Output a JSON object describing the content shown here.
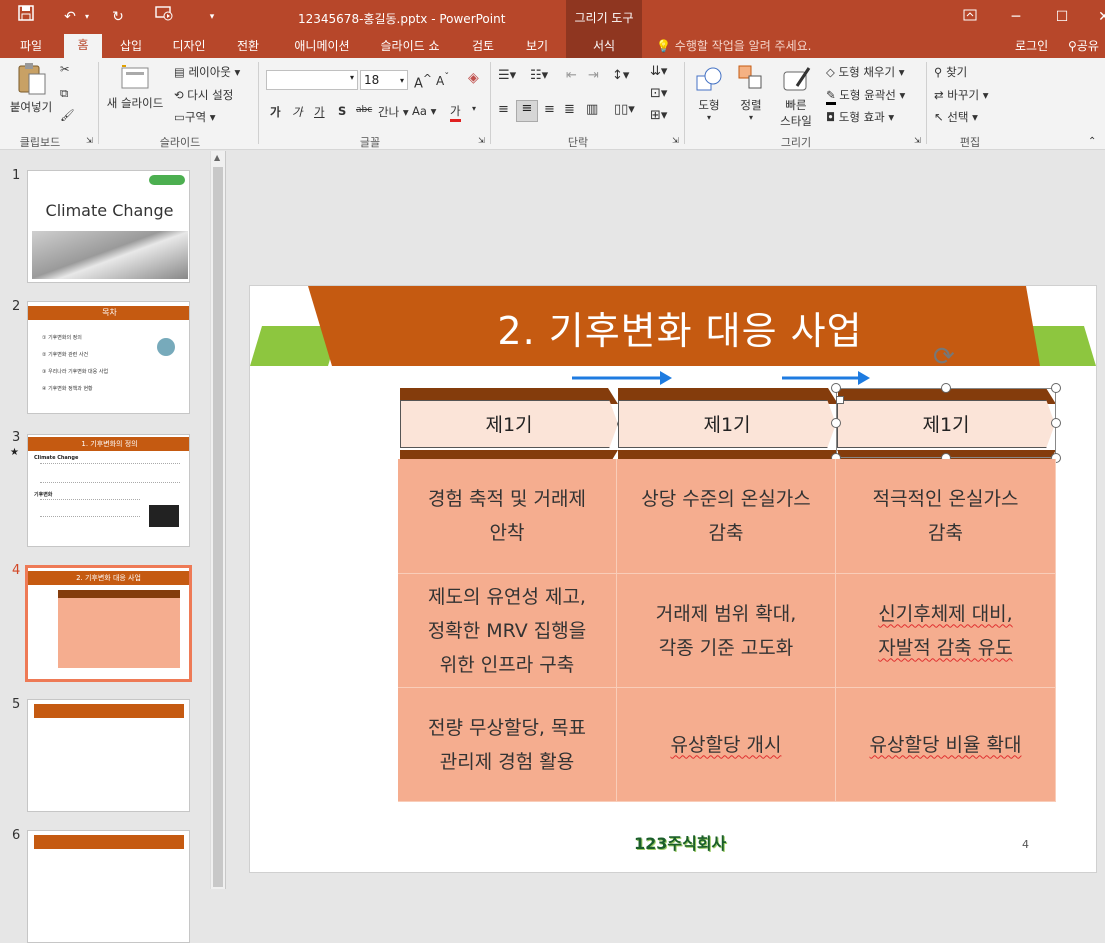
{
  "titlebar": {
    "filename": "12345678-홍길동.pptx - PowerPoint",
    "context_tool": "그리기 도구",
    "context_tab": "서식",
    "tell_me": "수행할 작업을 알려 주세요.",
    "login": "로그인",
    "share": "공유"
  },
  "tabs": [
    "파일",
    "홈",
    "삽입",
    "디자인",
    "전환",
    "애니메이션",
    "슬라이드 쇼",
    "검토",
    "보기"
  ],
  "ribbon": {
    "clipboard": {
      "paste": "붙여넣기",
      "group": "클립보드"
    },
    "slides": {
      "new_slide": "새 슬라이드",
      "layout": "레이아웃",
      "reset": "다시 설정",
      "section": "구역",
      "group": "슬라이드"
    },
    "font": {
      "font_name": "",
      "font_size": "18",
      "group": "글꼴",
      "bold": "가",
      "italic": "가",
      "underline": "가",
      "shadow": "S",
      "strike": "abc",
      "spacing": "간나",
      "case": "Aa",
      "color": "가"
    },
    "paragraph": {
      "group": "단락"
    },
    "drawing": {
      "shapes": "도형",
      "arrange": "정렬",
      "quick_styles_1": "빠른",
      "quick_styles_2": "스타일",
      "fill": "도형 채우기",
      "outline": "도형 윤곽선",
      "effects": "도형 효과",
      "group": "그리기"
    },
    "editing": {
      "find": "찾기",
      "replace": "바꾸기",
      "select": "선택",
      "group": "편집"
    }
  },
  "thumbnails": {
    "numbers": [
      "1",
      "2",
      "3",
      "4",
      "5",
      "6"
    ],
    "t1_title": "Climate Change",
    "t2_title": "목차",
    "t2_items": [
      "기후변화의 정의",
      "기후변화 관련 사건",
      "우리나라 기후변화 대응 사업",
      "기후변화 정책과 현황"
    ],
    "t3_title": "1. 기후변화의 정의",
    "t3_heading1": "Climate Change",
    "t3_heading2": "기후변화",
    "t4_title": "2. 기후변화 대응 사업"
  },
  "slide": {
    "title": "2. 기후변화 대응 사업",
    "headers": [
      "제1기",
      "제1기",
      "제1기"
    ],
    "rows": [
      [
        "경험 축적 및 거래제\n안착",
        "상당 수준의 온실가스\n감축",
        "적극적인 온실가스\n감축"
      ],
      [
        "제도의 유연성 제고,\n정확한 MRV 집행을\n위한 인프라 구축",
        "거래제 범위 확대,\n각종 기준 고도화",
        "신기후체제 대비,\n자발적 감축 유도"
      ],
      [
        "전량 무상할당, 목표\n관리제 경험 활용",
        "유상할당 개시",
        "유상할당 비율 확대"
      ]
    ],
    "logo_text": "123주식회사",
    "page_number": "4"
  },
  "colors": {
    "accent": "#b7472a",
    "slide_title_bg": "#c55a11",
    "green": "#8dc63f",
    "cell": "#f5ad8f",
    "header_cell": "#fbe4d8",
    "brown": "#843c0c",
    "arrow": "#1e7be0"
  }
}
